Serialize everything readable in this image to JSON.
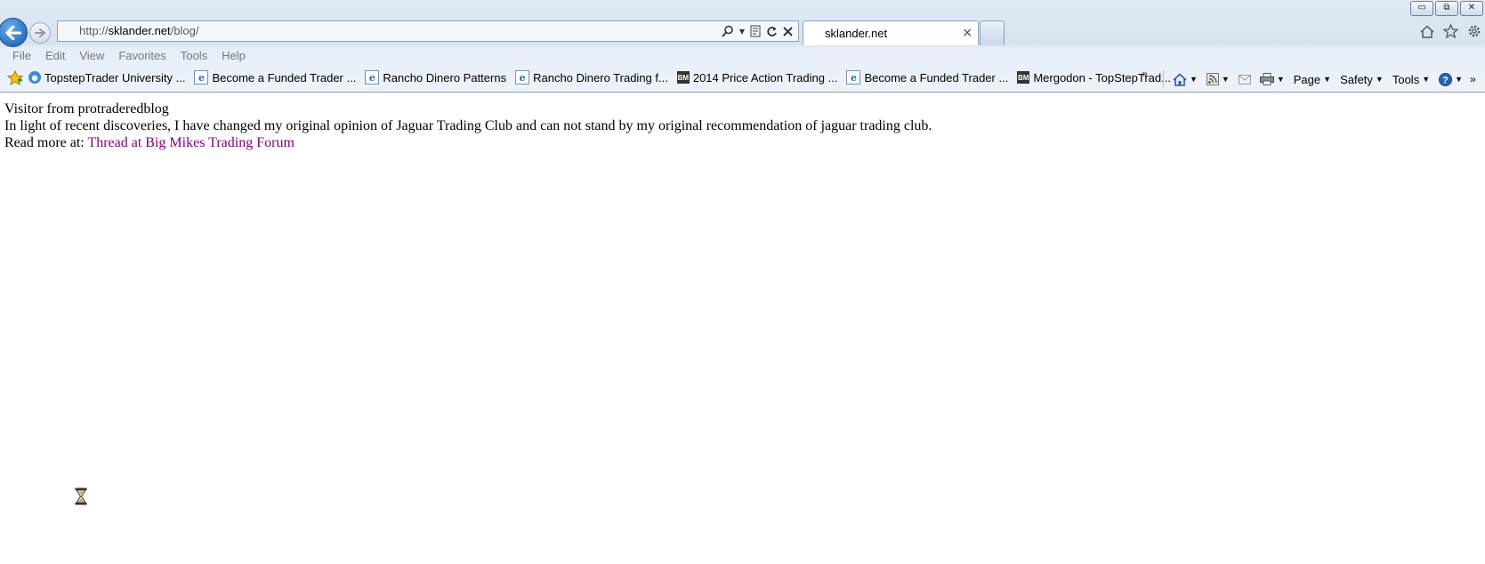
{
  "window": {
    "controls": {
      "minimize": "▭",
      "restore": "⧉",
      "close": "✕"
    }
  },
  "nav": {
    "back_icon": "back-arrow-icon",
    "forward_icon": "forward-arrow-icon",
    "address": {
      "prefix": "http://",
      "host": "sklander.net",
      "path": "/blog/"
    },
    "tab": {
      "title": "sklander.net",
      "close": "×"
    }
  },
  "menu": [
    "File",
    "Edit",
    "View",
    "Favorites",
    "Tools",
    "Help"
  ],
  "favorites": [
    {
      "label": "TopstepTrader University ...",
      "icon": "ts"
    },
    {
      "label": "Become a Funded Trader ...",
      "icon": "ie"
    },
    {
      "label": "Rancho Dinero  Patterns",
      "icon": "ie"
    },
    {
      "label": "Rancho Dinero  Trading f...",
      "icon": "ie"
    },
    {
      "label": "2014 Price Action Trading ...",
      "icon": "bm"
    },
    {
      "label": "Become a Funded Trader ...",
      "icon": "ie"
    },
    {
      "label": "Mergodon - TopStepTrad...",
      "icon": "bm"
    }
  ],
  "favorites_chevron": "»",
  "command_bar": {
    "page": "Page",
    "safety": "Safety",
    "tools": "Tools"
  },
  "page": {
    "line1": "Visitor from protraderedblog",
    "line2": "In light of recent discoveries, I have changed my original opinion of Jaguar Trading Club and can not stand by my original recommendation of jaguar trading club.",
    "line3_prefix": "Read more at: ",
    "link_text": "Thread at Big Mikes Trading Forum"
  },
  "colors": {
    "visited_link": "#800080",
    "chrome_bg": "#dfe9f5"
  }
}
